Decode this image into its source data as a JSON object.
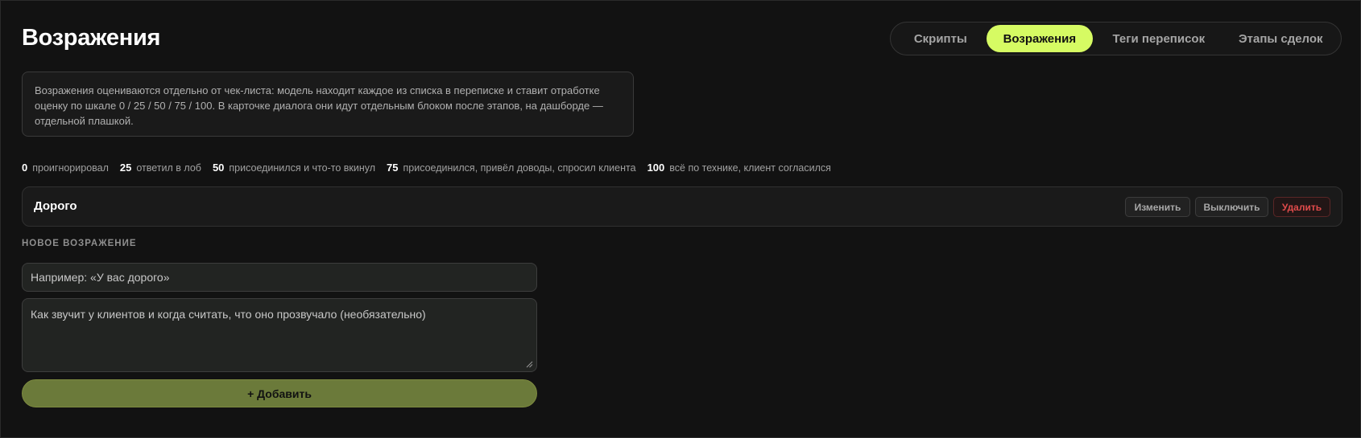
{
  "page": {
    "title": "Возражения"
  },
  "tabs": [
    {
      "label": "Скрипты",
      "active": false
    },
    {
      "label": "Возражения",
      "active": true
    },
    {
      "label": "Теги переписок",
      "active": false
    },
    {
      "label": "Этапы сделок",
      "active": false
    }
  ],
  "info": {
    "text": "Возражения оцениваются отдельно от чек-листа: модель находит каждое из списка в переписке и ставит отработке оценку по шкале 0 / 25 / 50 / 75 / 100. В карточке диалога они идут отдельным блоком после этапов, на дашборде — отдельной плашкой."
  },
  "scale": [
    {
      "score": "0",
      "label": "проигнорировал"
    },
    {
      "score": "25",
      "label": "ответил в лоб"
    },
    {
      "score": "50",
      "label": "присоединился и что-то вкинул"
    },
    {
      "score": "75",
      "label": "присоединился, привёл доводы, спросил клиента"
    },
    {
      "score": "100",
      "label": "всё по технике, клиент согласился"
    }
  ],
  "objections": [
    {
      "name": "Дорого",
      "edit_label": "Изменить",
      "disable_label": "Выключить",
      "delete_label": "Удалить"
    }
  ],
  "new_objection": {
    "section_label": "НОВОЕ ВОЗРАЖЕНИЕ",
    "name_placeholder": "Например: «У вас дорого»",
    "description_placeholder": "Как звучит у клиентов и когда считать, что оно прозвучало (необязательно)",
    "add_label": "+ Добавить"
  },
  "colors": {
    "background": "#121212",
    "accent": "#d6fb63",
    "add_button": "#6b7a3a",
    "danger": "#e04b4b"
  }
}
